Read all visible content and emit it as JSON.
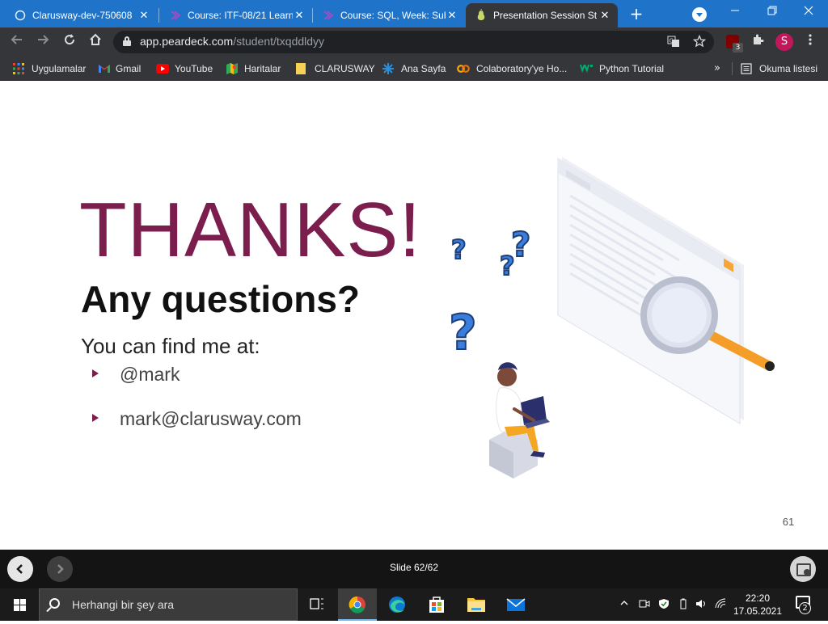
{
  "browser": {
    "tabs": [
      {
        "title": "Clarusway-dev-750608",
        "icon": "circle-icon"
      },
      {
        "title": "Course: ITF-08/21 Learn",
        "icon": "clarusway-logo-icon"
      },
      {
        "title": "Course: SQL, Week: Sub",
        "icon": "clarusway-logo-icon"
      },
      {
        "title": "Presentation Session St",
        "icon": "peardeck-icon",
        "active": true
      }
    ],
    "close_symbol": "✕",
    "new_tab_symbol": "+",
    "url_host": "app.peardeck.com",
    "url_path": "/student/txqddldyy",
    "extension_badge": "3",
    "profile_initial": "S"
  },
  "bookmarks": {
    "items": [
      {
        "label": "Uygulamalar",
        "icon": "apps-grid-icon"
      },
      {
        "label": "Gmail",
        "icon": "gmail-icon"
      },
      {
        "label": "YouTube",
        "icon": "youtube-icon"
      },
      {
        "label": "Haritalar",
        "icon": "maps-icon"
      },
      {
        "label": "CLARUSWAY",
        "icon": "folder-icon"
      },
      {
        "label": "Ana Sayfa",
        "icon": "ana-sayfa-icon"
      },
      {
        "label": "Colaboratory'ye Ho...",
        "icon": "colab-icon"
      },
      {
        "label": "Python Tutorial",
        "icon": "w3schools-icon"
      }
    ],
    "more_symbol": "»",
    "reading_list": "Okuma listesi"
  },
  "slide": {
    "title": "THANKS!",
    "subtitle": "Any questions?",
    "intro": "You can find me at:",
    "contacts": [
      "@mark",
      "mark@clarusway.com"
    ],
    "page_number": "61",
    "colors": {
      "title": "#7b1e4e",
      "question_mark": "#3b7ddd"
    }
  },
  "deck": {
    "counter": "Slide 62/62"
  },
  "taskbar": {
    "search_placeholder": "Herhangi bir şey ara",
    "time": "22:20",
    "date": "17.05.2021",
    "notification_count": "2"
  }
}
